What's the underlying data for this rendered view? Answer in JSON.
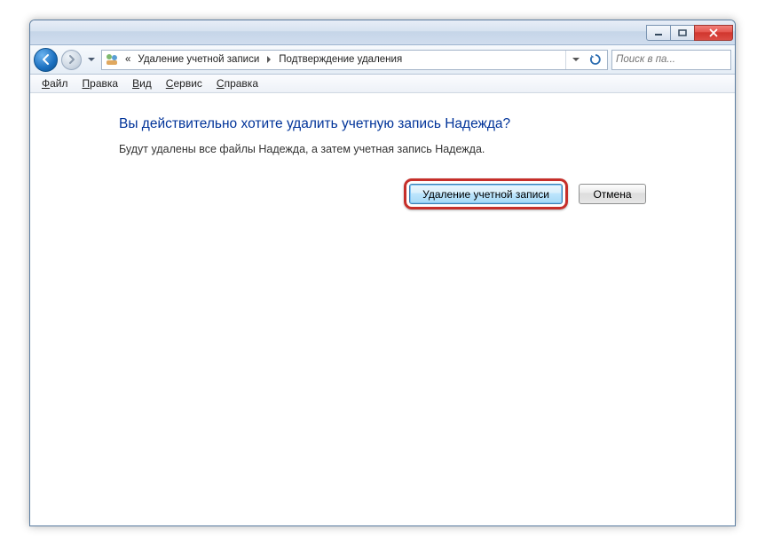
{
  "titlebar": {},
  "nav": {
    "breadcrumb_prefix": "«",
    "crumbs": [
      "Удаление учетной записи",
      "Подтверждение удаления"
    ],
    "search_placeholder": "Поиск в па..."
  },
  "menu": {
    "items": [
      {
        "hot": "Ф",
        "rest": "айл"
      },
      {
        "hot": "П",
        "rest": "равка"
      },
      {
        "hot": "В",
        "rest": "ид"
      },
      {
        "hot": "С",
        "rest": "ервис"
      },
      {
        "hot": "С",
        "rest": "правка"
      }
    ]
  },
  "content": {
    "heading": "Вы действительно хотите удалить учетную запись Надежда?",
    "body": "Будут удалены все файлы Надежда, а затем учетная запись Надежда.",
    "primary_button": "Удаление учетной записи",
    "cancel_button": "Отмена"
  }
}
